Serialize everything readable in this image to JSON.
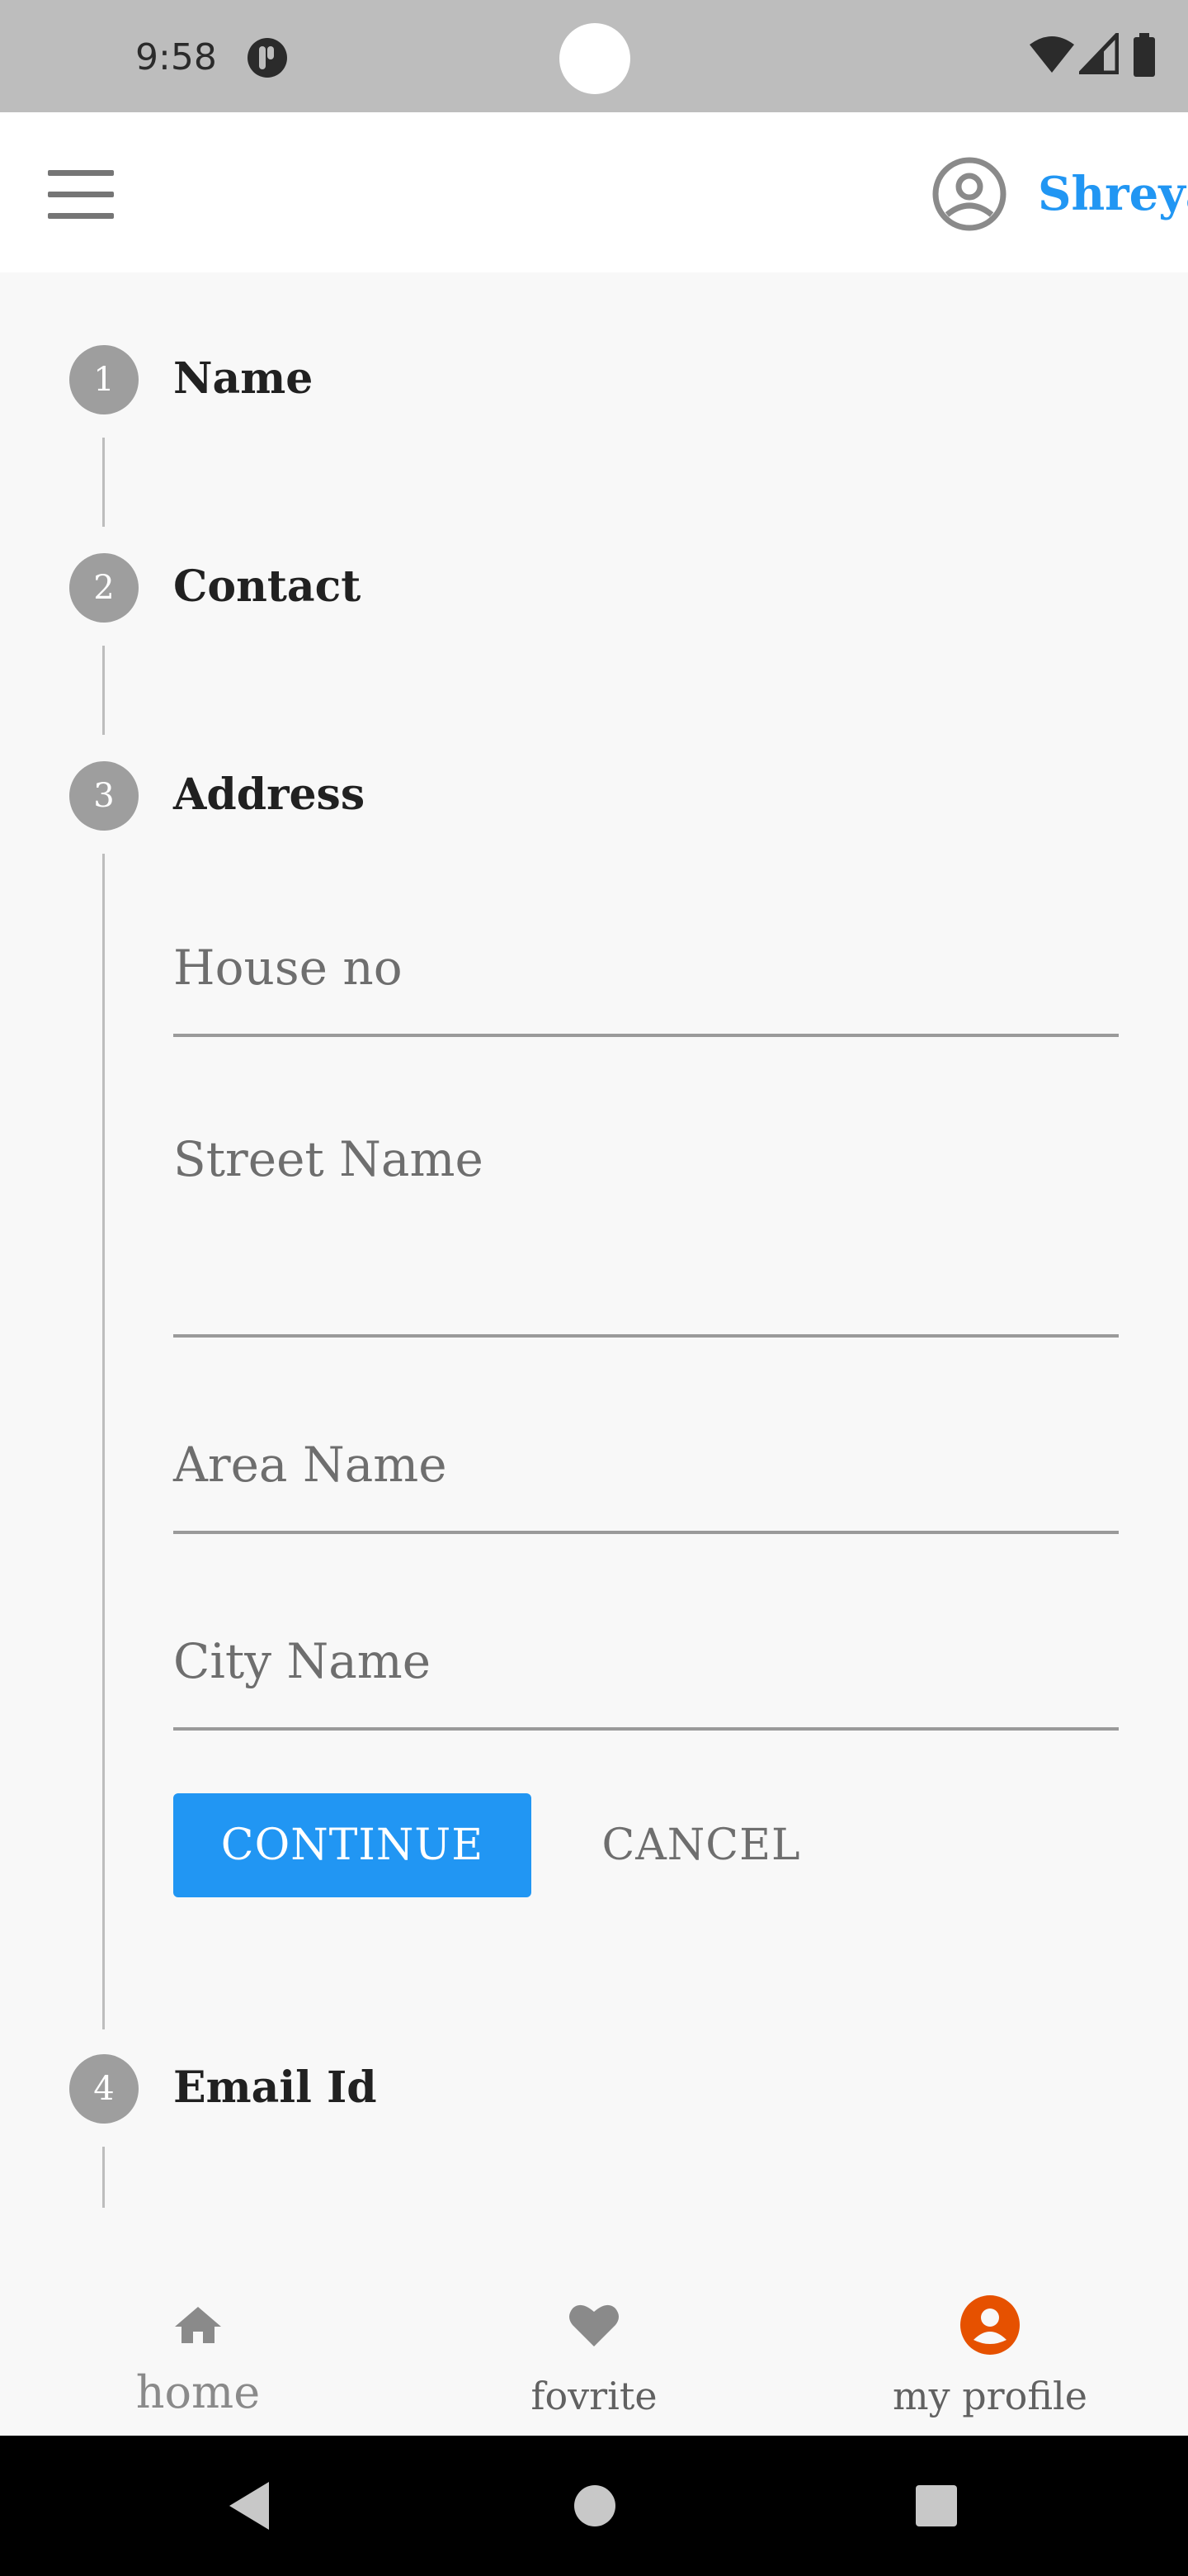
{
  "status_bar": {
    "time": "9:58",
    "icons": [
      "app-notification-icon",
      "wifi-icon",
      "signal-icon",
      "battery-icon"
    ]
  },
  "app_bar": {
    "menu_icon": "hamburger-menu-icon",
    "account_icon": "account-circle-icon",
    "user_name": "Shreya",
    "accent_color": "#2196f3"
  },
  "stepper": {
    "steps": [
      {
        "number": "1",
        "label": "Name"
      },
      {
        "number": "2",
        "label": "Contact"
      },
      {
        "number": "3",
        "label": "Address"
      },
      {
        "number": "4",
        "label": "Email Id"
      }
    ],
    "address_fields": {
      "house_no": "House no",
      "street_name": "Street Name",
      "area_name": "Area Name",
      "city_name": "City Name"
    },
    "continue_label": "CONTINUE",
    "cancel_label": "CANCEL"
  },
  "bottom_nav": {
    "items": [
      {
        "label": "home",
        "icon": "home-icon",
        "active": false
      },
      {
        "label": "fovrite",
        "icon": "heart-icon",
        "active": false
      },
      {
        "label": "my profile",
        "icon": "profile-icon",
        "active": true
      }
    ],
    "active_color": "#e65100"
  },
  "system_nav": {
    "icons": [
      "back-icon",
      "home-circle-icon",
      "recents-icon"
    ]
  }
}
